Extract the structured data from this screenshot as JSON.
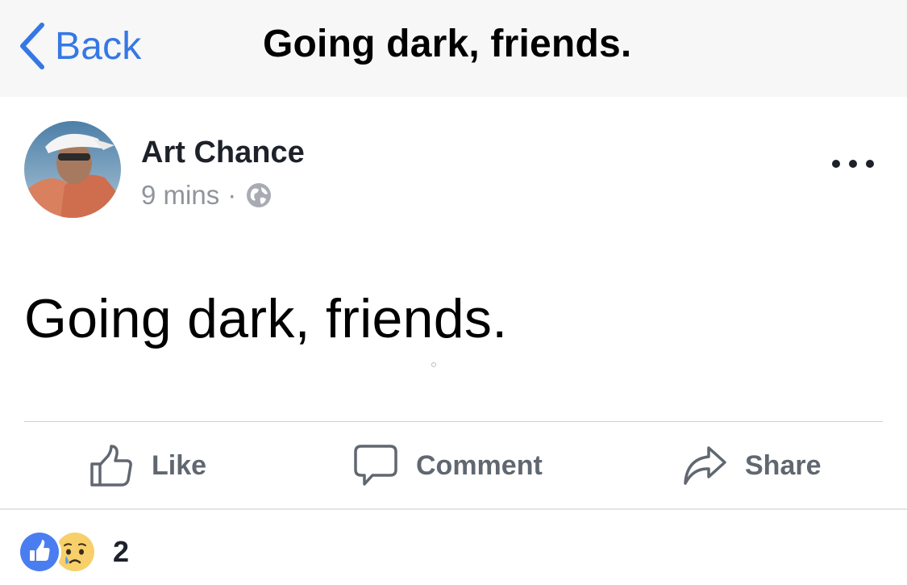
{
  "nav": {
    "back_label": "Back",
    "title": "Going dark, friends."
  },
  "post": {
    "author": "Art Chance",
    "time": "9 mins",
    "separator": "·",
    "privacy_icon": "globe-icon",
    "text": "Going dark, friends."
  },
  "actions": {
    "like": "Like",
    "comment": "Comment",
    "share": "Share"
  },
  "reactions": {
    "types": [
      "like-reaction-icon",
      "sad-reaction-icon"
    ],
    "count": "2"
  },
  "colors": {
    "accent": "#3578e5",
    "action_text": "#606770",
    "meta_text": "#90949c",
    "nav_bg": "#f7f7f7"
  }
}
